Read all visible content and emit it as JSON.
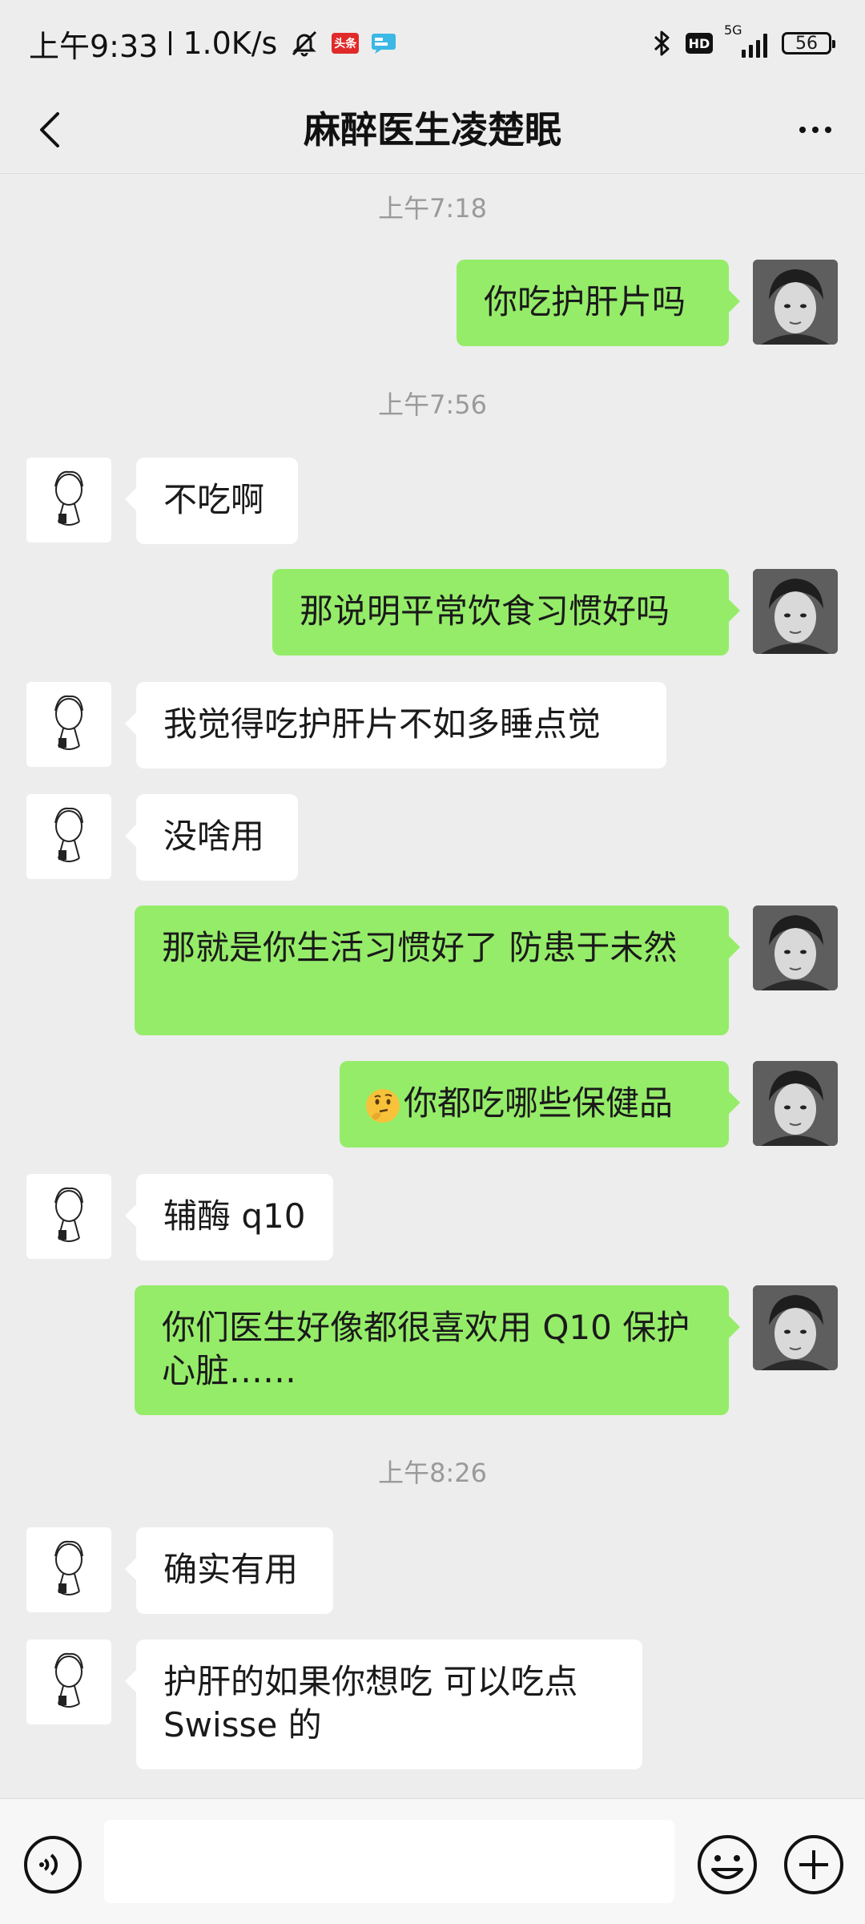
{
  "status_bar": {
    "time": "上午9:33",
    "network_speed": "1.0K/s",
    "news_badge": "头条",
    "network_type": "5G",
    "hd_label": "HD",
    "battery": "56"
  },
  "header": {
    "title": "麻醉医生凌楚眠"
  },
  "timestamps": [
    "上午7:18",
    "上午7:56",
    "上午8:26"
  ],
  "messages": [
    {
      "sender": "me",
      "text": "你吃护肝片吗"
    },
    {
      "sender": "other",
      "text": "不吃啊"
    },
    {
      "sender": "me",
      "text": "那说明平常饮食习惯好吗"
    },
    {
      "sender": "other",
      "text": "我觉得吃护肝片不如多睡点觉"
    },
    {
      "sender": "other",
      "text": "没啥用"
    },
    {
      "sender": "me",
      "text": "那就是你生活习惯好了 防患于未然"
    },
    {
      "sender": "me",
      "emoji": "thinking-face",
      "text": "你都吃哪些保健品"
    },
    {
      "sender": "other",
      "text": "辅酶 q10"
    },
    {
      "sender": "me",
      "text": "你们医生好像都很喜欢用 Q10 保护心脏……"
    },
    {
      "sender": "other",
      "text": "确实有用"
    },
    {
      "sender": "other",
      "text": "护肝的如果你想吃 可以吃点 Swisse 的"
    }
  ],
  "input": {
    "placeholder": "",
    "value": ""
  },
  "colors": {
    "background": "#ededed",
    "outgoing_bubble": "#95ec69",
    "incoming_bubble": "#ffffff",
    "timestamp_text": "#9a9a9a"
  }
}
